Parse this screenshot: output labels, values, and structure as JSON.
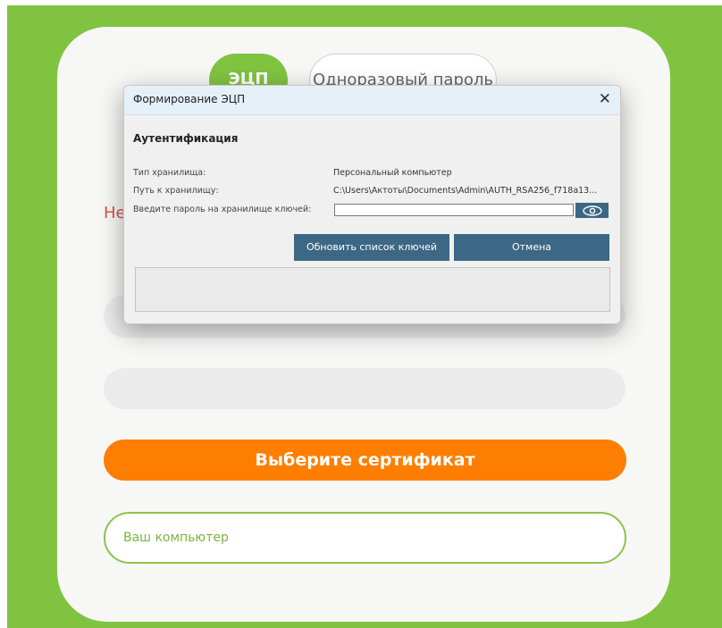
{
  "tabs": {
    "ecp_label": "ЭЦП",
    "otp_label": "Одноразовый пароль"
  },
  "partial_text": "Не",
  "main": {
    "select_cert_label": "Выберите сертификат",
    "computer_label": "Ваш компьютер"
  },
  "dialog": {
    "title": "Формирование ЭЦП",
    "close_glyph": "✕",
    "section": "Аутентификация",
    "storage_type_label": "Тип хранилища:",
    "storage_type_value": "Персональный компьютер",
    "storage_path_label": "Путь к хранилищу:",
    "storage_path_value": "C:\\Users\\Актоты\\Documents\\Admin\\AUTH_RSA256_f718a13...",
    "password_label": "Введите пароль на хранилище ключей:",
    "password_value": "",
    "refresh_button": "Обновить список ключей",
    "cancel_button": "Отмена",
    "eye_icon": "eye-icon"
  },
  "colors": {
    "green": "#80c341",
    "orange": "#fd7e00",
    "dialog_button": "#3d6885",
    "error_red": "#d9534f"
  }
}
